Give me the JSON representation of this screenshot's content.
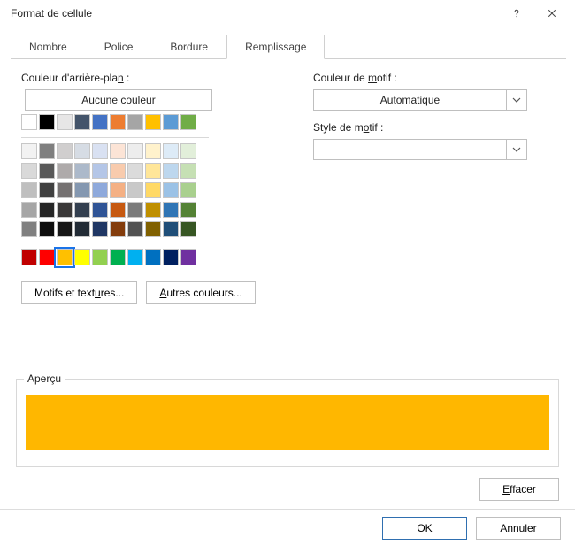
{
  "title": "Format de cellule",
  "tabs": {
    "nombre": "Nombre",
    "police": "Police",
    "bordure": "Bordure",
    "remplissage": "Remplissage"
  },
  "labels": {
    "bg_prefix": "Couleur d'arrière-pla",
    "bg_ul": "n",
    "bg_suffix": " :",
    "pattern_color_prefix": "Couleur de ",
    "pattern_color_ul": "m",
    "pattern_color_suffix": "otif :",
    "pattern_style_prefix": "Style de m",
    "pattern_style_ul": "o",
    "pattern_style_suffix": "tif :",
    "preview": "Aperçu"
  },
  "buttons": {
    "no_color": "Aucune couleur",
    "fill_effects_prefix": "Motifs et text",
    "fill_effects_ul": "u",
    "fill_effects_suffix": "res...",
    "more_colors_ul": "A",
    "more_colors_rest": "utres couleurs...",
    "clear_ul": "E",
    "clear_rest": "ffacer",
    "ok": "OK",
    "cancel": "Annuler"
  },
  "pattern_color": {
    "value": "Automatique"
  },
  "pattern_style": {
    "value": ""
  },
  "preview_color": "#ffb700",
  "selected_color": "#ffc000",
  "palette": {
    "theme_row": [
      "#ffffff",
      "#000000",
      "#e7e6e6",
      "#44546a",
      "#4472c4",
      "#ed7d31",
      "#a5a5a5",
      "#ffc000",
      "#5b9bd5",
      "#70ad47"
    ],
    "theme_shades": [
      [
        "#f2f2f2",
        "#7f7f7f",
        "#d0cece",
        "#d6dce4",
        "#d9e1f2",
        "#fce4d6",
        "#ededed",
        "#fff2cc",
        "#ddebf7",
        "#e2efda"
      ],
      [
        "#d9d9d9",
        "#595959",
        "#aeaaaa",
        "#acb9ca",
        "#b4c6e7",
        "#f8cbad",
        "#dbdbdb",
        "#ffe699",
        "#bdd7ee",
        "#c6e0b4"
      ],
      [
        "#bfbfbf",
        "#404040",
        "#757171",
        "#8497b0",
        "#8ea9db",
        "#f4b084",
        "#c9c9c9",
        "#ffd966",
        "#9bc2e6",
        "#a9d08e"
      ],
      [
        "#a6a6a6",
        "#262626",
        "#3a3838",
        "#333f4f",
        "#305496",
        "#c65911",
        "#7b7b7b",
        "#bf8f00",
        "#2f75b5",
        "#548235"
      ],
      [
        "#808080",
        "#0d0d0d",
        "#161616",
        "#222b35",
        "#203764",
        "#833c0c",
        "#525252",
        "#806000",
        "#1f4e78",
        "#375623"
      ]
    ],
    "standard": [
      "#c00000",
      "#ff0000",
      "#ffc000",
      "#ffff00",
      "#92d050",
      "#00b050",
      "#00b0f0",
      "#0070c0",
      "#002060",
      "#7030a0"
    ]
  }
}
